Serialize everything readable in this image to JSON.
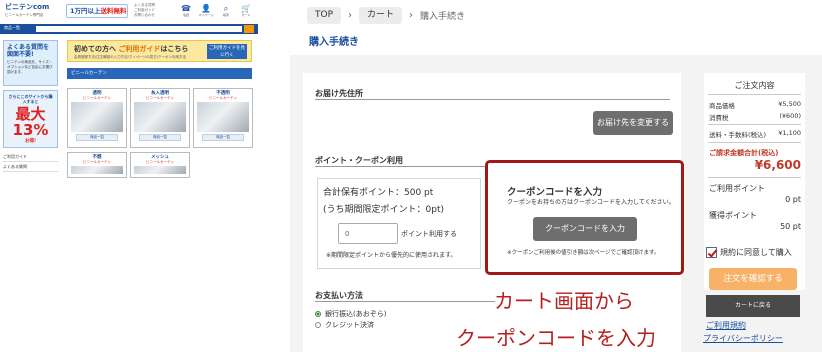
{
  "mini_site": {
    "logo": "ビニテンcom",
    "logo_sub": "ビニールカーテン専門店",
    "shipping_badge_a": "1万円以上",
    "shipping_badge_b": "送料無料",
    "header_links": [
      "よくある質問",
      "ご利用ガイド",
      "お問い合わせ"
    ],
    "header_icons": [
      {
        "icon": "phone-icon",
        "label": "電話"
      },
      {
        "icon": "user-icon",
        "label": "マイページ"
      },
      {
        "icon": "search-icon",
        "label": "検索"
      },
      {
        "icon": "cart-icon",
        "label": "カート"
      }
    ],
    "search_category": "商品一覧",
    "faq_title": "よくある質問を図面不要!",
    "faq_text": "ビニテンの商品を、サイズ・オプションなど自由にお選び頂けます。",
    "rank_text": "さらにこのサイトから購入すると",
    "rank_big": "最大13%",
    "rank_sub": "お得!",
    "side_links": [
      "ご利用ガイド",
      "よくある質問"
    ],
    "guide_title_a": "初めての方へ",
    "guide_title_b": "ご利用ガイド",
    "guide_title_c": "はこちら",
    "guide_sub": "会員登録方法/注文確認の入力方法/マイページの見方/クーポン利用方法",
    "guide_button": "ご利用ガイドを見に行く",
    "category_bar": "ビニールカーテン",
    "cards": [
      {
        "title": "透明",
        "sub": "ビニールカーテン",
        "button": "商品一覧"
      },
      {
        "title": "糸入透明",
        "sub": "ビニールカーテン",
        "button": "商品一覧"
      },
      {
        "title": "不透明",
        "sub": "ビニールカーテン",
        "button": "商品一覧"
      },
      {
        "title": "不燃",
        "sub": "ビニールカーテン",
        "button": ""
      },
      {
        "title": "メッシュ",
        "sub": "ビニールカーテン",
        "button": ""
      }
    ]
  },
  "breadcrumb": {
    "top": "TOP",
    "cart": "カート",
    "current": "購入手続き"
  },
  "page_title": "購入手続き",
  "delivery": {
    "heading": "お届け先住所",
    "change_button": "お届け先を変更する"
  },
  "points": {
    "heading": "ポイント・クーポン利用",
    "total": "合計保有ポイント：500 pt",
    "limited": "(うち期間限定ポイント：0pt)",
    "input_value": "0",
    "use_label": "ポイント利用する",
    "note": "※期間限定ポイントから優先的に使用されます。"
  },
  "coupon": {
    "title": "クーポンコードを入力",
    "desc": "クーポンをお持ちの方はクーポンコードを入力してください。",
    "button": "クーポンコードを入力",
    "note": "※クーポンご利用後の値引き額は次ページでご確認頂けます。"
  },
  "payment": {
    "heading": "お支払い方法",
    "options": [
      "銀行振込(あおぞら)",
      "クレジット決済"
    ],
    "selected": 0
  },
  "overlay": {
    "line1": "カート画面から",
    "line2": "クーポンコードを入力"
  },
  "summary": {
    "title": "ご注文内容",
    "rows": [
      {
        "label": "商品価格",
        "value": "¥5,500"
      },
      {
        "label": "消費税",
        "value": "(¥600)"
      },
      {
        "label": "送料・手数料(税込)",
        "value": "¥1,100"
      }
    ],
    "total_label": "ご請求金額合計(税込)",
    "total_value": "¥6,600",
    "use_points_label": "ご利用ポイント",
    "use_points_value": "0 pt",
    "earn_points_label": "獲得ポイント",
    "earn_points_value": "50 pt",
    "agree_label": "規約に同意して購入",
    "confirm_button": "注文を確認する",
    "cart_back_button": "カートに戻る",
    "terms_link": "ご利用規約",
    "privacy_link": "プライバシーポリシー"
  },
  "colors": {
    "brand_blue": "#1a4f9c",
    "accent_red": "#b42020",
    "confirm_orange": "#f7b267"
  }
}
